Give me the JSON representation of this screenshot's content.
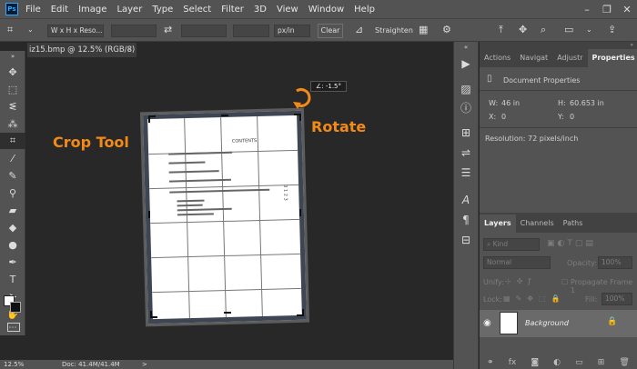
{
  "app": {
    "logo": "Ps"
  },
  "menu": [
    "File",
    "Edit",
    "Image",
    "Layer",
    "Type",
    "Select",
    "Filter",
    "3D",
    "View",
    "Window",
    "Help"
  ],
  "window_controls": [
    "–",
    "❐",
    "✕"
  ],
  "options": {
    "ratio_value": "W x H x Reso...",
    "unit_value": "px/in",
    "clear_label": "Clear",
    "straighten_label": "Straighten"
  },
  "document": {
    "tab_title": "iz15.bmp @ 12.5% (RGB/8) *",
    "close": "✕"
  },
  "canvas": {
    "rotation_readout": "∠: -1.5°",
    "annotation_crop": "Crop Tool",
    "annotation_rotate": "Rotate",
    "doc_heading": "CONTENTS",
    "doc_page_mark": "3 1 2 3"
  },
  "status": {
    "zoom": "12.5%",
    "doc_size": "Doc: 41.4M/41.4M",
    "arrow": ">"
  },
  "properties_panel": {
    "tabs": [
      "Actions",
      "Navigat",
      "Adjustr",
      "Properties"
    ],
    "active_tab": "Properties",
    "section_title": "Document Properties",
    "w_label": "W:",
    "w_value": "46 in",
    "h_label": "H:",
    "h_value": "60.653 in",
    "x_label": "X:",
    "x_value": "0",
    "y_label": "Y:",
    "y_value": "0",
    "resolution": "Resolution: 72 pixels/inch"
  },
  "layers_panel": {
    "tabs": [
      "Layers",
      "Channels",
      "Paths"
    ],
    "active_tab": "Layers",
    "kind_placeholder": "Kind",
    "blend_mode": "Normal",
    "opacity_label": "Opacity:",
    "opacity_value": "100%",
    "unify_label": "Unify:",
    "propagate_label": "Propagate Frame 1",
    "lock_label": "Lock:",
    "fill_label": "Fill:",
    "fill_value": "100%",
    "layer_name": "Background"
  },
  "colors": {
    "accent_orange": "#f28a1a",
    "panel_bg": "#535353",
    "canvas_bg": "#282828"
  }
}
